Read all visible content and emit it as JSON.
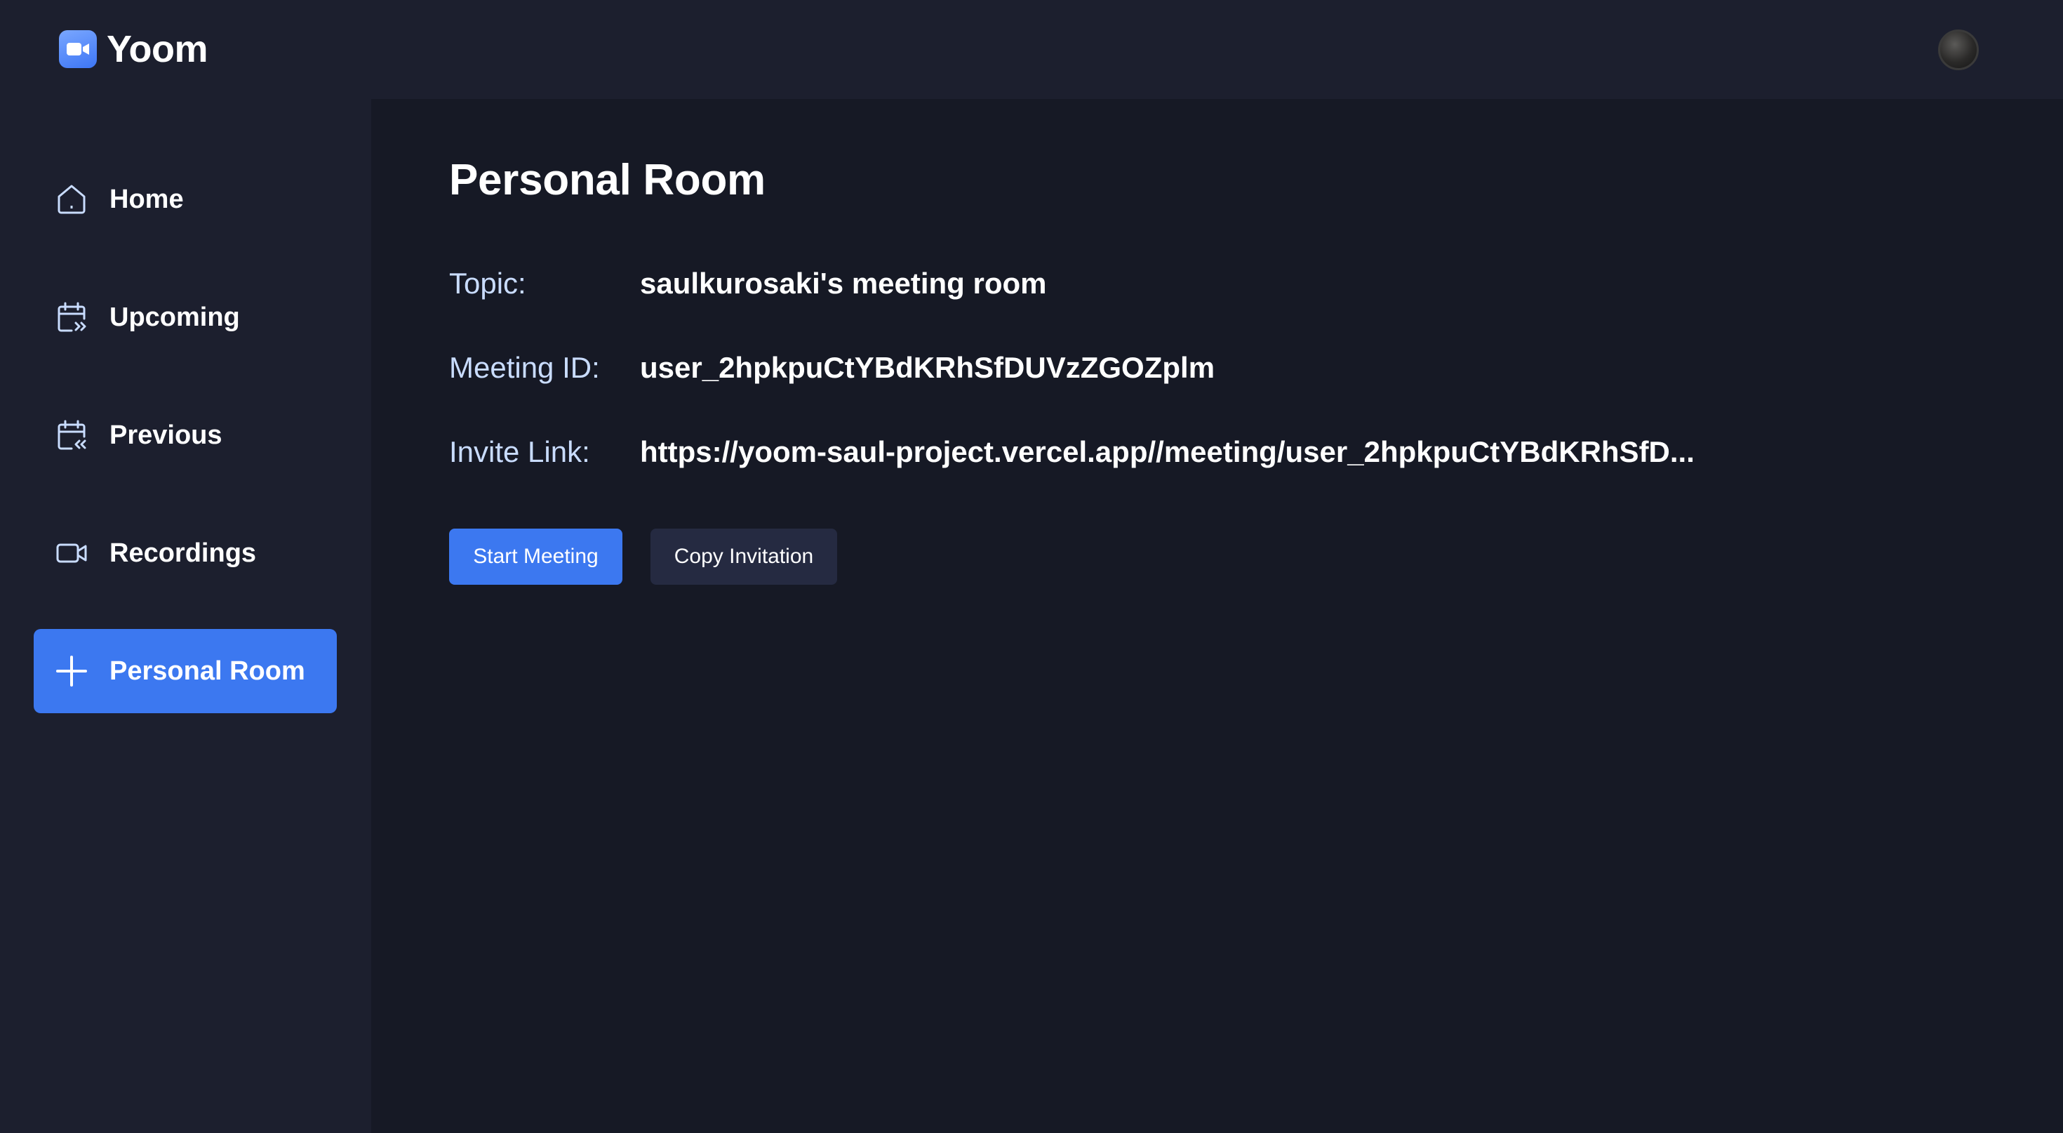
{
  "app": {
    "name": "Yoom"
  },
  "sidebar": {
    "items": [
      {
        "label": "Home",
        "icon": "home-icon",
        "active": false
      },
      {
        "label": "Upcoming",
        "icon": "calendar-upcoming-icon",
        "active": false
      },
      {
        "label": "Previous",
        "icon": "calendar-previous-icon",
        "active": false
      },
      {
        "label": "Recordings",
        "icon": "video-icon",
        "active": false
      },
      {
        "label": "Personal Room",
        "icon": "plus-icon",
        "active": true
      }
    ]
  },
  "main": {
    "title": "Personal Room",
    "details": [
      {
        "label": "Topic:",
        "value": "saulkurosaki's meeting room"
      },
      {
        "label": "Meeting ID:",
        "value": "user_2hpkpuCtYBdKRhSfDUVzZGOZplm"
      },
      {
        "label": "Invite Link:",
        "value": "https://yoom-saul-project.vercel.app//meeting/user_2hpkpuCtYBdKRhSfD..."
      }
    ],
    "buttons": {
      "start": "Start Meeting",
      "copy": "Copy Invitation"
    }
  },
  "colors": {
    "accent": "#3c78f0",
    "sidebar_bg": "#1c1f2e",
    "main_bg": "#161925",
    "label_color": "#c9dcff",
    "secondary_button": "#252a41"
  }
}
